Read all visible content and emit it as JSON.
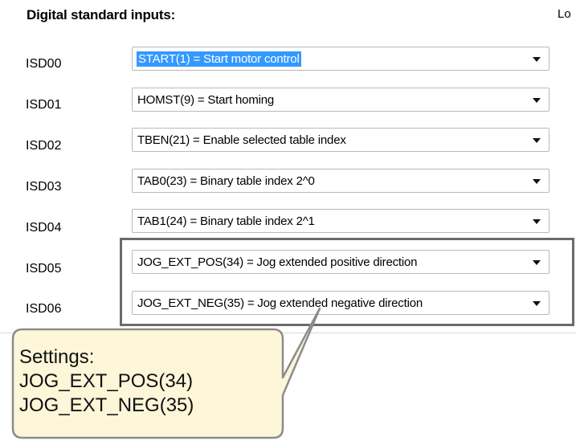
{
  "header": {
    "title": "Digital standard inputs:",
    "right_clipped_label": "Lo"
  },
  "inputs": [
    {
      "label": "ISD00",
      "value": "START(1) = Start motor control"
    },
    {
      "label": "ISD01",
      "value": "HOMST(9) = Start homing"
    },
    {
      "label": "ISD02",
      "value": "TBEN(21) = Enable selected table index"
    },
    {
      "label": "ISD03",
      "value": "TAB0(23) = Binary table index 2^0"
    },
    {
      "label": "ISD04",
      "value": "TAB1(24) = Binary table index 2^1"
    },
    {
      "label": "ISD05",
      "value": "JOG_EXT_POS(34) = Jog extended positive direction"
    },
    {
      "label": "ISD06",
      "value": "JOG_EXT_NEG(35) = Jog extended negative direction"
    }
  ],
  "callout": {
    "lines": [
      "Settings:",
      "JOG_EXT_POS(34)",
      "JOG_EXT_NEG(35)"
    ],
    "fill": "#fdf6d8",
    "border": "#8c8c8c"
  },
  "colors": {
    "selection": "#3399ff",
    "highlight_border": "#6b6b6b"
  },
  "icons": {
    "dropdown": "chevron-down-icon"
  }
}
